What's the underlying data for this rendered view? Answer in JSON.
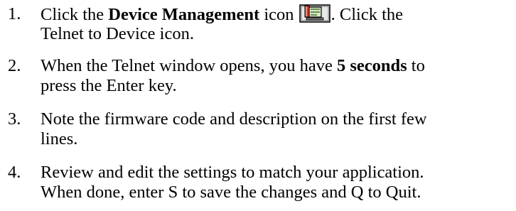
{
  "steps": [
    {
      "number": "1.",
      "line1_before": "Click the ",
      "line1_bold": "Device Management",
      "line1_mid": " icon ",
      "icon": "device-management-icon",
      "line1_after": ". Click the",
      "line2": "Telnet to Device icon."
    },
    {
      "number": "2.",
      "line1_before": "When the Telnet window opens, you have ",
      "line1_bold": "5 seconds",
      "line1_after": " to",
      "line2": "press the Enter key."
    },
    {
      "number": "3.",
      "line1": "Note the firmware code and description on the first few",
      "line2": "lines."
    },
    {
      "number": "4.",
      "line1": "Review and edit the settings to match your application.",
      "line2": "When done, enter S to save the changes and Q to Quit."
    }
  ]
}
